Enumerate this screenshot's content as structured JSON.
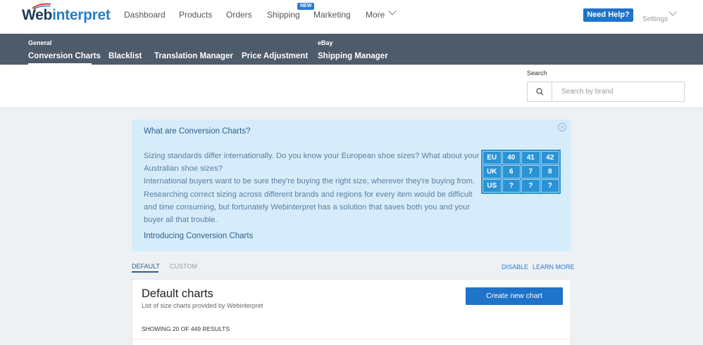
{
  "header": {
    "logo_main": "Web",
    "logo_accent": "interpret",
    "nav": [
      {
        "label": "Dashboard"
      },
      {
        "label": "Products"
      },
      {
        "label": "Orders"
      },
      {
        "label": "Shipping",
        "badge": "NEW"
      },
      {
        "label": "Marketing"
      },
      {
        "label": "More"
      }
    ],
    "help_button": "Need Help?",
    "settings": "Settings"
  },
  "subnav": {
    "general_label": "General",
    "ebay_label": "eBay",
    "items": [
      {
        "label": "Conversion Charts",
        "active": true
      },
      {
        "label": "Blacklist"
      },
      {
        "label": "Translation Manager"
      },
      {
        "label": "Price Adjustment"
      },
      {
        "label": "Shipping Manager"
      }
    ]
  },
  "search": {
    "label": "Search",
    "placeholder": "Search by brand"
  },
  "info_panel": {
    "title": "What are Conversion Charts?",
    "close_icon": "×",
    "text": "Sizing standards differ internationally. Do you know your European shoe sizes? What about your Australian shoe sizes?\nInternational buyers want to be sure they're buying the right size, wherever they're buying from. Researching correct sizing across different brands and regions for every item would be difficult and time consuming, but fortunately Webinterpret has a solution that saves both you and your buyer all that trouble.",
    "link": "Introducing Conversion Charts",
    "size_table": [
      [
        "EU",
        "40",
        "41",
        "42"
      ],
      [
        "UK",
        "6",
        "7",
        "8"
      ],
      [
        "US",
        "?",
        "?",
        "?"
      ]
    ]
  },
  "tabs": {
    "default": "DEFAULT",
    "custom": "CUSTOM",
    "disable": "DISABLE",
    "learn_more": "LEARN MORE"
  },
  "charts_card": {
    "title": "Default charts",
    "subtitle": "List of size charts provided by Webinterpret",
    "create_button": "Create new chart",
    "results": "SHOWING 20 OF 449 RESULTS"
  },
  "colors": {
    "brand_blue": "#1f73c9",
    "subnav_bg": "#4e5b6b",
    "info_bg": "#d6ecfa"
  }
}
